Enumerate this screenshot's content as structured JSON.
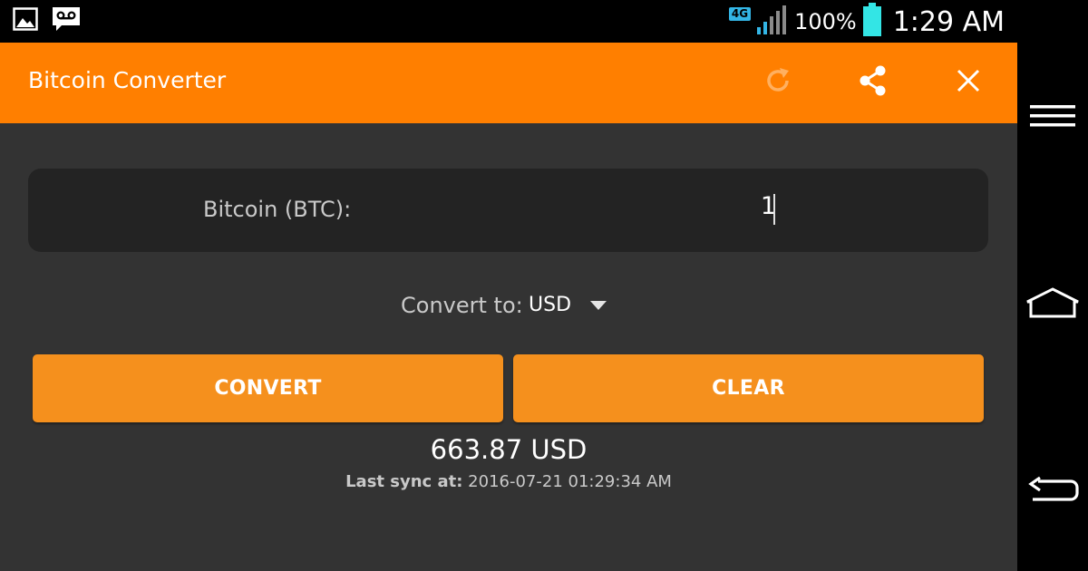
{
  "status_bar": {
    "network_type": "4G",
    "battery_percent": "100%",
    "time": "1:29 AM",
    "icons": [
      "image-icon",
      "voicemail-icon",
      "signal-icon",
      "battery-icon"
    ]
  },
  "toolbar": {
    "title": "Bitcoin Converter",
    "background_color": "#ff7f00",
    "actions": [
      "refresh-icon",
      "share-icon",
      "close-icon"
    ]
  },
  "converter": {
    "input_label": "Bitcoin (BTC):",
    "input_value": "1",
    "convert_to_label": "Convert to:",
    "selected_currency": "USD",
    "convert_button": "CONVERT",
    "clear_button": "CLEAR",
    "button_color": "#f5901d",
    "result": "663.87 USD",
    "last_sync_label": "Last sync at:",
    "last_sync_value": "2016-07-21 01:29:34 AM"
  },
  "navigation_bar": {
    "buttons": [
      "menu-icon",
      "home-icon",
      "back-icon"
    ]
  }
}
